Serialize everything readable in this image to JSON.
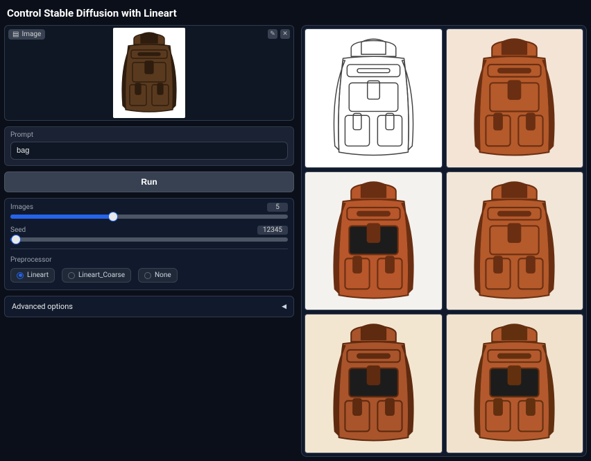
{
  "header": {
    "title": "Control Stable Diffusion with Lineart"
  },
  "input_image": {
    "label": "Image",
    "tools": {
      "edit": "✎",
      "close": "✕"
    }
  },
  "prompt": {
    "label": "Prompt",
    "value": "bag"
  },
  "run": {
    "label": "Run"
  },
  "sliders": {
    "images": {
      "label": "Images",
      "value": "5",
      "min": 1,
      "max": 12,
      "fill_pct": 37
    },
    "seed": {
      "label": "Seed",
      "value": "12345",
      "min": 0,
      "max": 4294967295,
      "fill_pct": 2
    }
  },
  "preprocessor": {
    "label": "Preprocessor",
    "options": [
      {
        "label": "Lineart",
        "selected": true
      },
      {
        "label": "Lineart_Coarse",
        "selected": false
      },
      {
        "label": "None",
        "selected": false
      }
    ]
  },
  "advanced": {
    "label": "Advanced options"
  },
  "gallery": {
    "cells": [
      {
        "kind": "lineart",
        "bg": "#ffffff",
        "leather": "none",
        "stroke": "#444",
        "accent": "none"
      },
      {
        "kind": "rendered",
        "bg": "#f3e4d6",
        "leather": "#b55a2b",
        "stroke": "#6a2f12",
        "accent": "#b55a2b"
      },
      {
        "kind": "rendered",
        "bg": "#f4f2ee",
        "leather": "#b8572b",
        "stroke": "#6a2f12",
        "accent": "#1c1c1c"
      },
      {
        "kind": "rendered",
        "bg": "#f1e6d7",
        "leather": "#b55a2b",
        "stroke": "#6a2f12",
        "accent": "#b55a2b"
      },
      {
        "kind": "rendered",
        "bg": "#f3e6d0",
        "leather": "#a9542b",
        "stroke": "#5e2a10",
        "accent": "#1c1c1c"
      },
      {
        "kind": "rendered",
        "bg": "#f1e2ce",
        "leather": "#b4592e",
        "stroke": "#63300f",
        "accent": "#1c1c1c"
      }
    ]
  },
  "input_preview": {
    "leather": "#5a3a1f",
    "stroke": "#2e1d0e",
    "bg": "#ffffff"
  }
}
